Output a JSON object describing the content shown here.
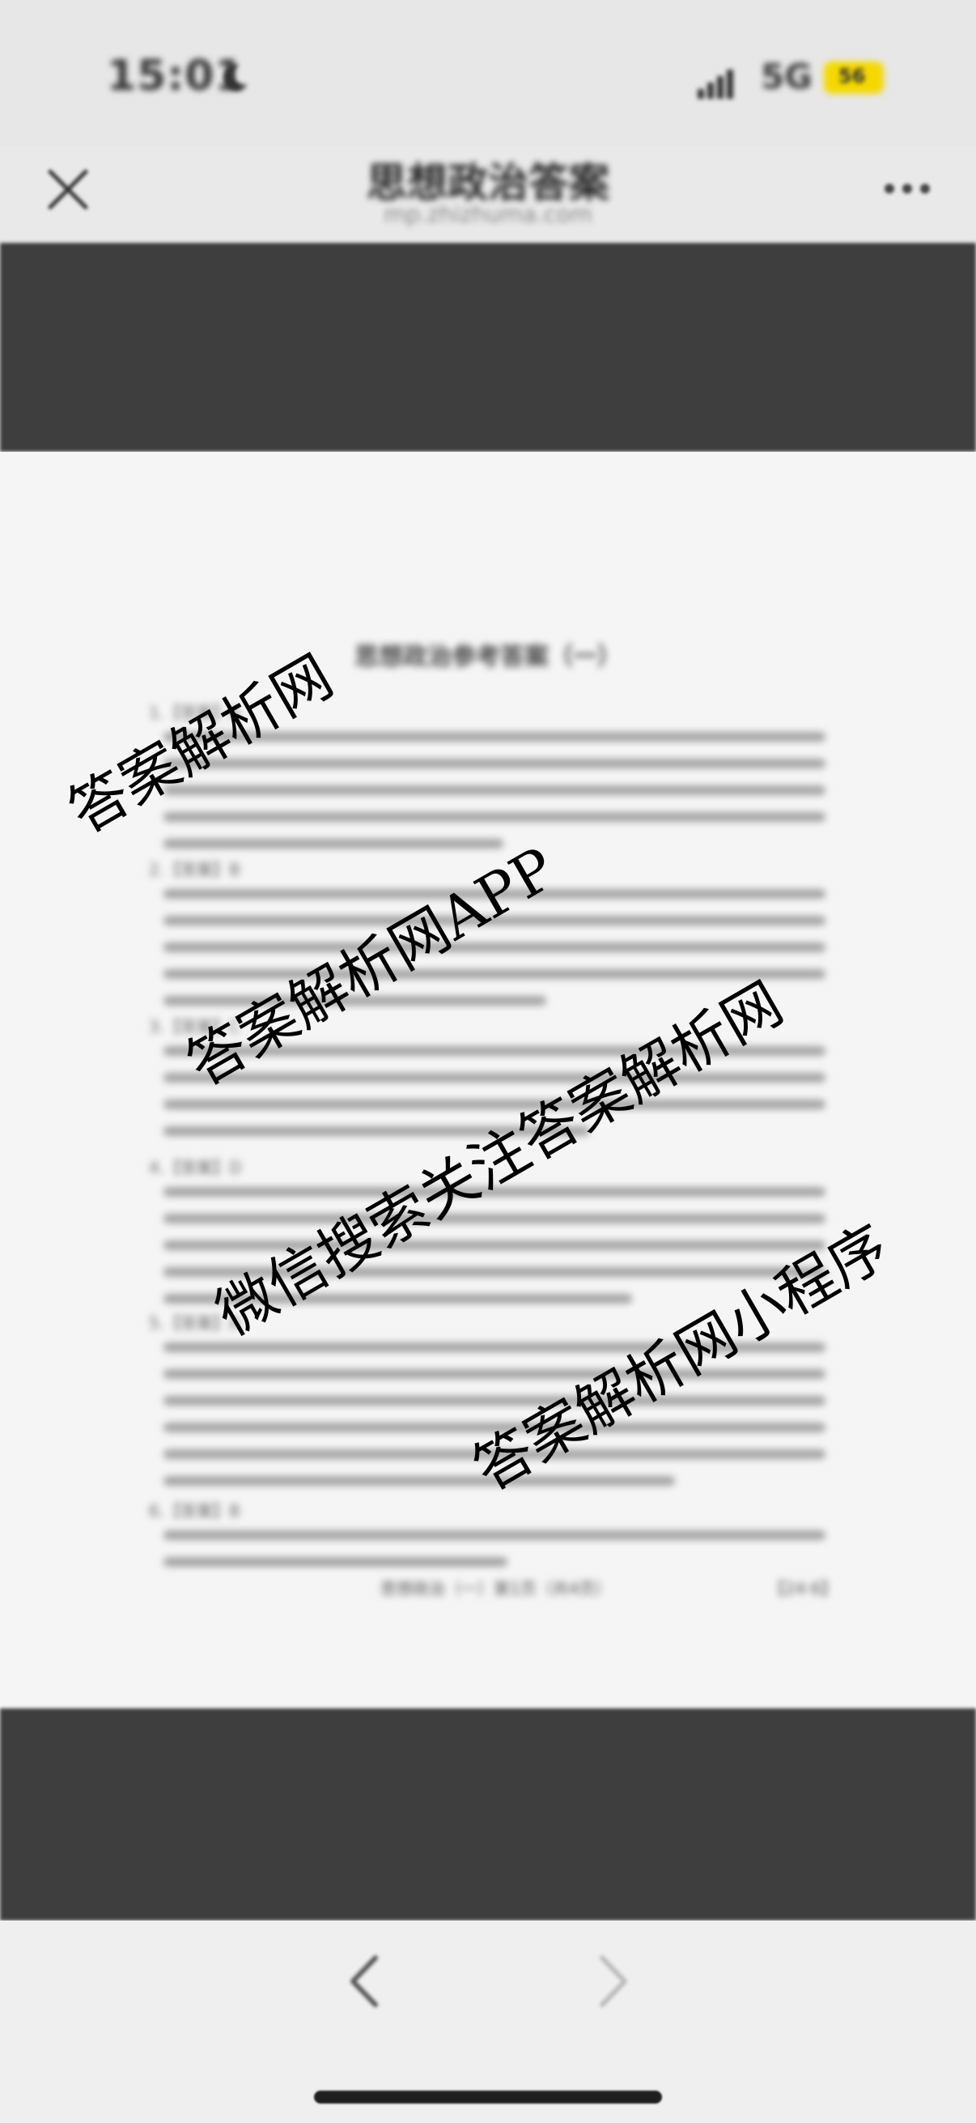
{
  "status_bar": {
    "time": "15:01",
    "network": "5G",
    "battery": "56"
  },
  "nav": {
    "title": "思想政治答案",
    "subtitle": "mp.zhizhuma.com"
  },
  "document": {
    "title": "思想政治参考答案（一）",
    "footer": "思想政治（一）第1页（共4页）",
    "page_number": "【24·6】",
    "question_labels": [
      "1.【答案】A",
      "2.【答案】B",
      "3.【答案】C",
      "4.【答案】D",
      "5.【答案】A",
      "6.【答案】B"
    ]
  },
  "watermarks": [
    "答案解析网",
    "答案解析网APP",
    "微信搜索关注答案解析网",
    "答案解析网小程序"
  ],
  "icons": {
    "close": "close-icon",
    "more": "more-icon",
    "prev": "chevron-left-icon",
    "next": "chevron-right-icon",
    "moon": "moon-icon",
    "signal": "signal-icon",
    "battery": "battery-icon"
  },
  "colors": {
    "battery": "#f5d800",
    "viewer_dark": "#3e3e3e",
    "page": "#f5f5f5"
  }
}
